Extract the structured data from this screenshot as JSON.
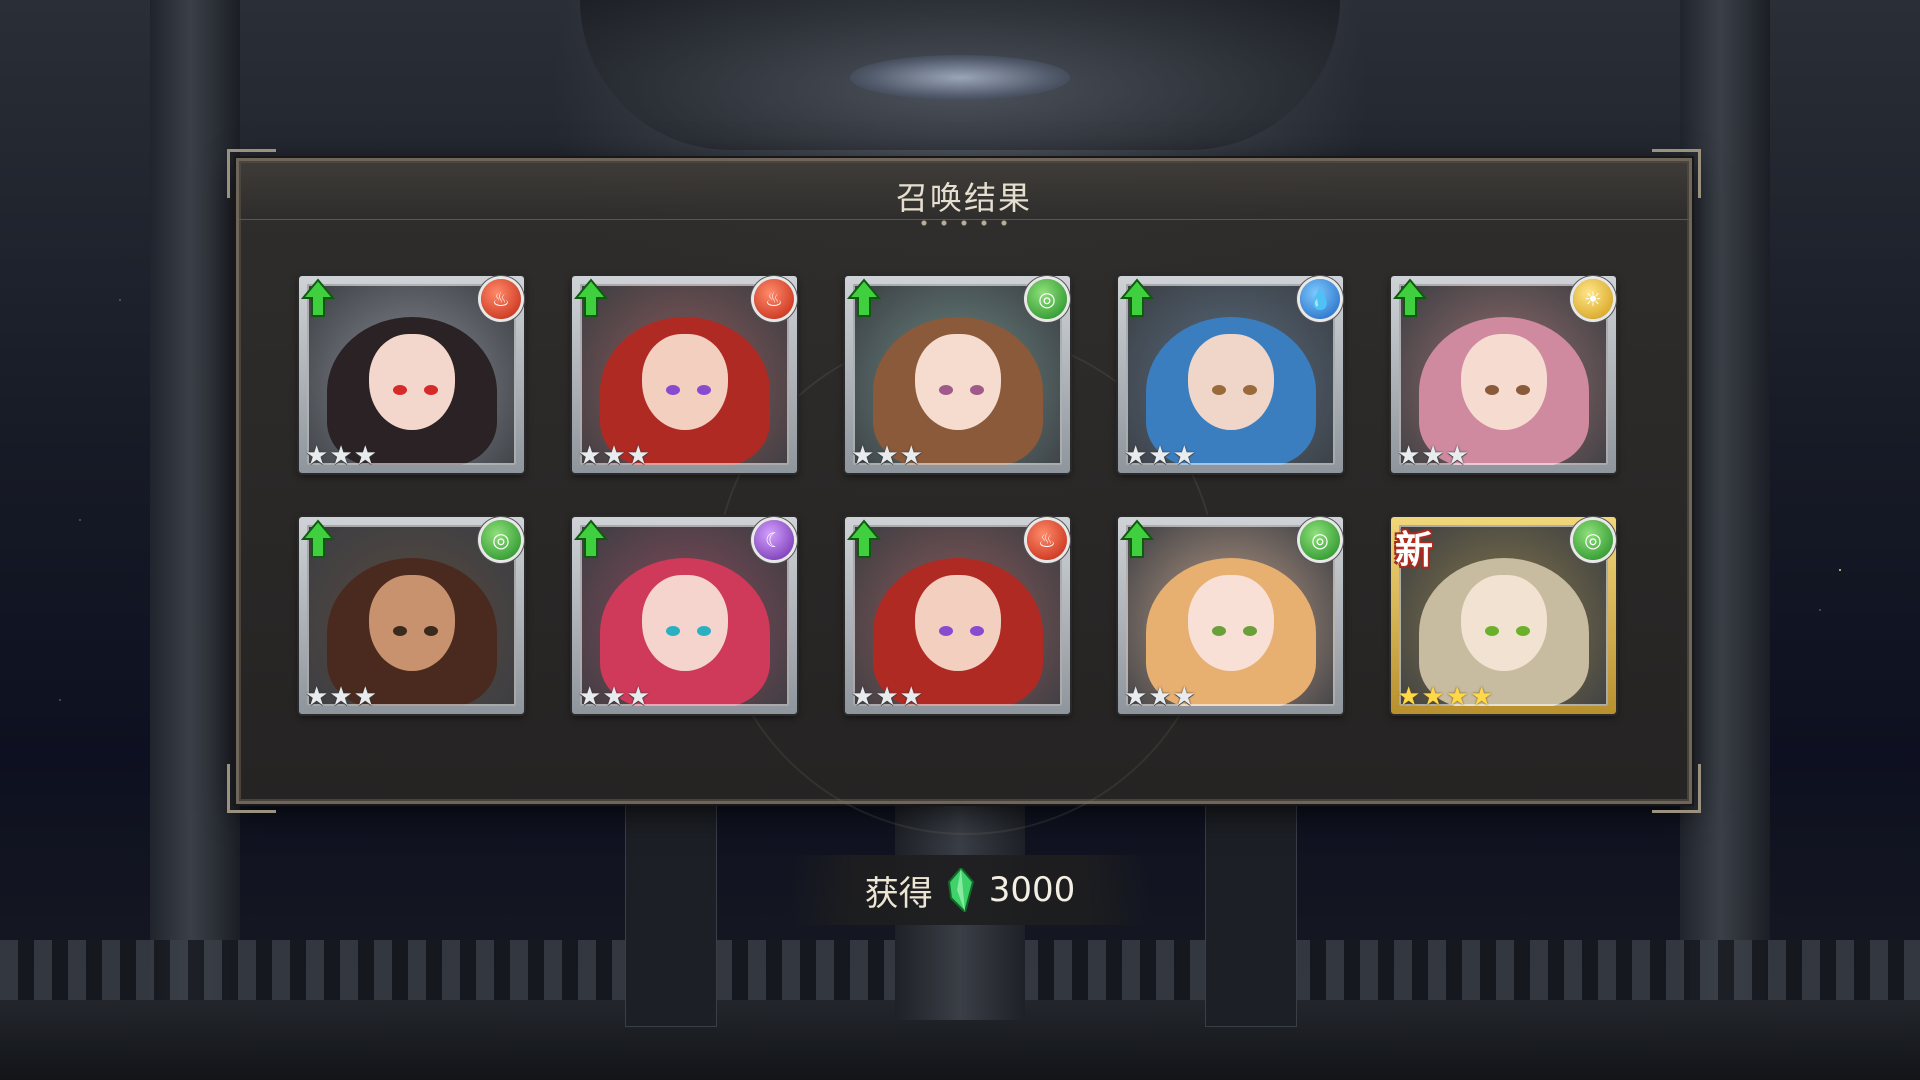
{
  "window": {
    "title": "召唤结果"
  },
  "results": [
    {
      "element": "fire",
      "element_color": "#c02410",
      "stars": 3,
      "rarity": "silver",
      "hair": "#2a2224",
      "skin": "#f4d7cc",
      "eye": "#d62a2a",
      "bgtone": "#8a8f96",
      "is_new": false,
      "upgrade": true
    },
    {
      "element": "fire",
      "element_color": "#c02410",
      "stars": 3,
      "rarity": "silver",
      "hair": "#b02a24",
      "skin": "#f3cfc0",
      "eye": "#8a4ad0",
      "bgtone": "#8f5a5a",
      "is_new": false,
      "upgrade": true
    },
    {
      "element": "wind",
      "element_color": "#1e8a22",
      "stars": 3,
      "rarity": "silver",
      "hair": "#8a5a3a",
      "skin": "#f6dccf",
      "eye": "#a05a8a",
      "bgtone": "#6e8a84",
      "is_new": false,
      "upgrade": true
    },
    {
      "element": "water",
      "element_color": "#1b64c0",
      "stars": 3,
      "rarity": "silver",
      "hair": "#3a7ec0",
      "skin": "#f0d6c8",
      "eye": "#9a6a3a",
      "bgtone": "#5a6e82",
      "is_new": false,
      "upgrade": true
    },
    {
      "element": "light",
      "element_color": "#d09a10",
      "stars": 3,
      "rarity": "silver",
      "hair": "#d08aa0",
      "skin": "#f6dcd0",
      "eye": "#8a5a3a",
      "bgtone": "#9a7070",
      "is_new": false,
      "upgrade": true
    },
    {
      "element": "wind",
      "element_color": "#1e8a22",
      "stars": 3,
      "rarity": "silver",
      "hair": "#4a2a1e",
      "skin": "#c8926e",
      "eye": "#3a2a1e",
      "bgtone": "#5a4a40",
      "is_new": false,
      "upgrade": true
    },
    {
      "element": "dark",
      "element_color": "#6a2aa8",
      "stars": 3,
      "rarity": "silver",
      "hair": "#d03a5a",
      "skin": "#f4d4cc",
      "eye": "#2ab0c0",
      "bgtone": "#8a4a5a",
      "is_new": false,
      "upgrade": true
    },
    {
      "element": "fire",
      "element_color": "#c02410",
      "stars": 3,
      "rarity": "silver",
      "hair": "#b02a24",
      "skin": "#f3cfc0",
      "eye": "#8a4ad0",
      "bgtone": "#8f5a5a",
      "is_new": false,
      "upgrade": true
    },
    {
      "element": "wind",
      "element_color": "#1e8a22",
      "stars": 3,
      "rarity": "silver",
      "hair": "#e8b070",
      "skin": "#f8e0d6",
      "eye": "#6aa03a",
      "bgtone": "#c0a08a",
      "is_new": false,
      "upgrade": true
    },
    {
      "element": "wind",
      "element_color": "#1e8a22",
      "stars": 4,
      "rarity": "gold",
      "hair": "#c8bca0",
      "skin": "#f2e2d2",
      "eye": "#6ab02a",
      "bgtone": "#8a7a4a",
      "is_new": true,
      "new_label": "新",
      "upgrade": false
    }
  ],
  "reward": {
    "label": "获得",
    "icon": "green-crystal-icon",
    "amount": "3000"
  }
}
